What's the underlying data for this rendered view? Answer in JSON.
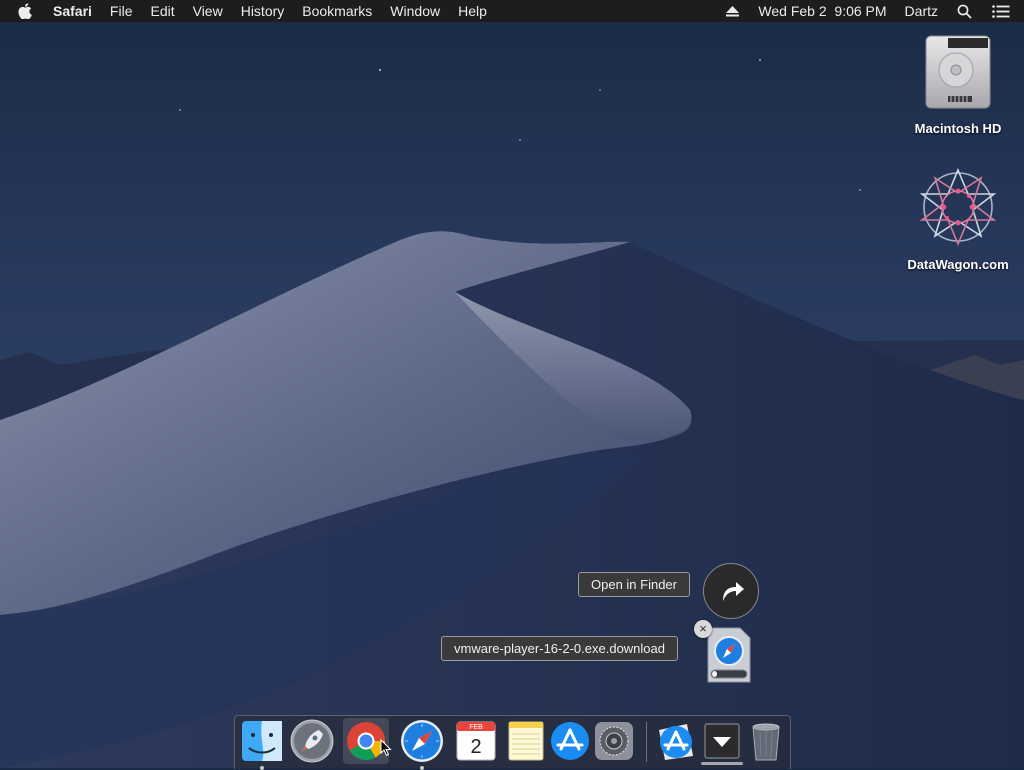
{
  "menubar": {
    "apple_icon": "apple-logo-icon",
    "app_name": "Safari",
    "menus": [
      "File",
      "Edit",
      "View",
      "History",
      "Bookmarks",
      "Window",
      "Help"
    ],
    "eject_icon": "eject-icon",
    "clock": "Wed Feb 2  9:06 PM",
    "user": "Dartz",
    "search_icon": "spotlight-search-icon",
    "notification_icon": "notification-center-icon"
  },
  "desktop": {
    "icons": [
      {
        "label": "Macintosh HD",
        "icon": "hard-drive-icon"
      },
      {
        "label": "DataWagon.com",
        "icon": "datawagon-volume-icon"
      }
    ]
  },
  "download_stack": {
    "open_in_finder_label": "Open in Finder",
    "file_name": "vmware-player-16-2-0.exe.download",
    "close_symbol": "×",
    "progress": 0.15
  },
  "dock": {
    "calendar_month": "FEB",
    "calendar_day": "2",
    "apps": [
      {
        "name": "Finder",
        "icon": "finder-icon",
        "running": true
      },
      {
        "name": "Launchpad",
        "icon": "launchpad-icon",
        "running": false
      },
      {
        "name": "Google Chrome",
        "icon": "chrome-icon",
        "running": false
      },
      {
        "name": "Safari",
        "icon": "safari-icon",
        "running": true
      },
      {
        "name": "Calendar",
        "icon": "calendar-icon",
        "running": false
      },
      {
        "name": "Notes",
        "icon": "notes-icon",
        "running": false
      },
      {
        "name": "App Store",
        "icon": "app-store-icon",
        "running": false
      },
      {
        "name": "System Preferences",
        "icon": "system-preferences-icon",
        "running": false
      },
      {
        "name": "App Store",
        "icon": "app-store-icon",
        "running": false
      },
      {
        "name": "Downloads",
        "icon": "downloads-stack-icon",
        "running": false
      },
      {
        "name": "Trash",
        "icon": "trash-icon",
        "running": false
      }
    ]
  },
  "colors": {
    "menubar_bg": "#1d1d20",
    "tag_bg": "#3a3a3c",
    "safari_blue": "#1e7fe0"
  }
}
